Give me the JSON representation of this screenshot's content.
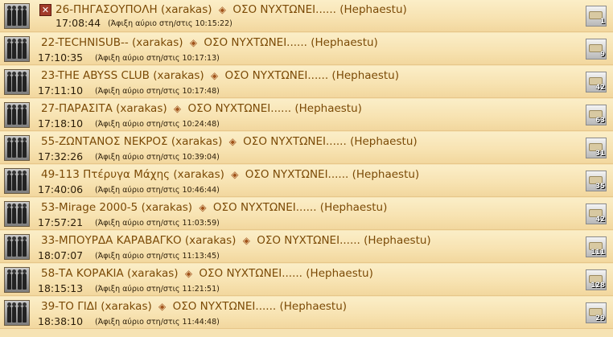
{
  "movements": [
    {
      "name": "26-ΠΗΓΑΣΟΥΠΟΛΗ",
      "owner": "(xarakas)",
      "target": "ΟΣΟ ΝΥΧΤΩΝΕΙ......",
      "target_owner": "(Hephaestu)",
      "time": "17:08:44",
      "arrival": "(Άφιξη αύριο στη/στις 10:15:22)",
      "count": "1",
      "cancel": "✕"
    },
    {
      "name": "22-TECHNISUB--",
      "owner": "(xarakas)",
      "target": "ΟΣΟ ΝΥΧΤΩΝΕΙ......",
      "target_owner": "(Hephaestu)",
      "time": "17:10:35",
      "arrival": "(Άφιξη αύριο στη/στις 10:17:13)",
      "count": "9"
    },
    {
      "name": "23-THE ABYSS CLUB",
      "owner": "(xarakas)",
      "target": "ΟΣΟ ΝΥΧΤΩΝΕΙ......",
      "target_owner": "(Hephaestu)",
      "time": "17:11:10",
      "arrival": "(Άφιξη αύριο στη/στις 10:17:48)",
      "count": "42"
    },
    {
      "name": "27-ΠΑΡΑΣΙΤΑ",
      "owner": "(xarakas)",
      "target": "ΟΣΟ ΝΥΧΤΩΝΕΙ......",
      "target_owner": "(Hephaestu)",
      "time": "17:18:10",
      "arrival": "(Άφιξη αύριο στη/στις 10:24:48)",
      "count": "63"
    },
    {
      "name": "55-ΖΩΝΤΑΝΟΣ ΝΕΚΡΟΣ",
      "owner": "(xarakas)",
      "target": "ΟΣΟ ΝΥΧΤΩΝΕΙ......",
      "target_owner": "(Hephaestu)",
      "time": "17:32:26",
      "arrival": "(Άφιξη αύριο στη/στις 10:39:04)",
      "count": "31"
    },
    {
      "name": "49-113 Πτέρυγα Μάχης",
      "owner": "(xarakas)",
      "target": "ΟΣΟ ΝΥΧΤΩΝΕΙ......",
      "target_owner": "(Hephaestu)",
      "time": "17:40:06",
      "arrival": "(Άφιξη αύριο στη/στις 10:46:44)",
      "count": "35"
    },
    {
      "name": "53-Mirage 2000-5",
      "owner": "(xarakas)",
      "target": "ΟΣΟ ΝΥΧΤΩΝΕΙ......",
      "target_owner": "(Hephaestu)",
      "time": "17:57:21",
      "arrival": "(Άφιξη αύριο στη/στις 11:03:59)",
      "count": "42"
    },
    {
      "name": "33-ΜΠΟΥΡΔΑ ΚΑΡΑΒΑΓΚΟ",
      "owner": "(xarakas)",
      "target": "ΟΣΟ ΝΥΧΤΩΝΕΙ......",
      "target_owner": "(Hephaestu)",
      "time": "18:07:07",
      "arrival": "(Άφιξη αύριο στη/στις 11:13:45)",
      "count": "111"
    },
    {
      "name": "58-ΤΑ ΚΟΡΑΚΙΑ",
      "owner": "(xarakas)",
      "target": "ΟΣΟ ΝΥΧΤΩΝΕΙ......",
      "target_owner": "(Hephaestu)",
      "time": "18:15:13",
      "arrival": "(Άφιξη αύριο στη/στις 11:21:51)",
      "count": "128"
    },
    {
      "name": "39-ΤΟ ΓΙΔΙ",
      "owner": "(xarakas)",
      "target": "ΟΣΟ ΝΥΧΤΩΝΕΙ......",
      "target_owner": "(Hephaestu)",
      "time": "18:38:10",
      "arrival": "(Άφιξη αύριο στη/στις 11:44:48)",
      "count": "29"
    }
  ],
  "icons": {
    "unit": "troops-icon",
    "arrow": "arrow-right-icon",
    "resource": "cargo-icon",
    "cancel": "cancel-icon"
  },
  "colors": {
    "background": "#f6e3b4",
    "text": "#7b4a06",
    "cancel": "#a23a2a"
  }
}
